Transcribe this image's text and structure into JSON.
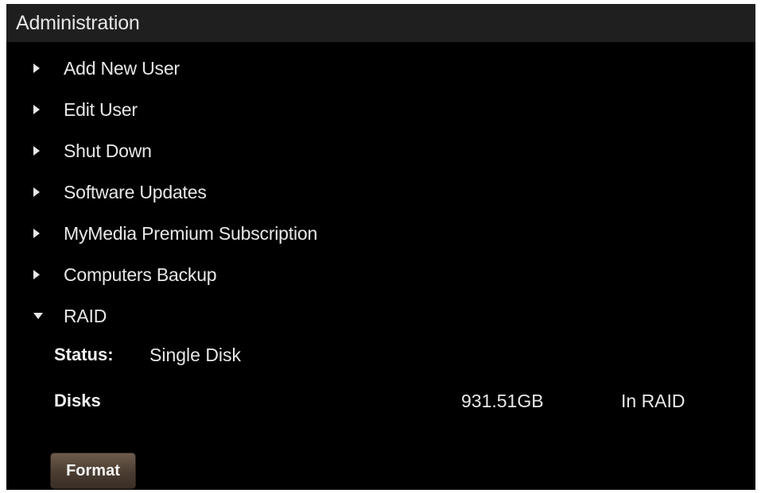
{
  "title": "Administration",
  "menu": {
    "items": [
      {
        "label": "Add New User",
        "expanded": false,
        "icon": "triangle-right-icon"
      },
      {
        "label": "Edit User",
        "expanded": false,
        "icon": "triangle-right-icon"
      },
      {
        "label": "Shut Down",
        "expanded": false,
        "icon": "triangle-right-icon"
      },
      {
        "label": "Software Updates",
        "expanded": false,
        "icon": "triangle-right-icon"
      },
      {
        "label": "MyMedia Premium Subscription",
        "expanded": false,
        "icon": "triangle-right-icon"
      },
      {
        "label": "Computers Backup",
        "expanded": false,
        "icon": "triangle-right-icon"
      },
      {
        "label": "RAID",
        "expanded": true,
        "icon": "triangle-down-icon"
      }
    ]
  },
  "raid": {
    "status_label": "Status:",
    "status_value": "Single Disk",
    "disks_label": "Disks",
    "disk": {
      "size": "931.51GB",
      "state": "In RAID"
    },
    "format_button_label": "Format"
  },
  "colors": {
    "background": "#000000",
    "titlebar": "#1f1f1f",
    "text": "#e8e8e8",
    "button": "#4a3c31"
  }
}
